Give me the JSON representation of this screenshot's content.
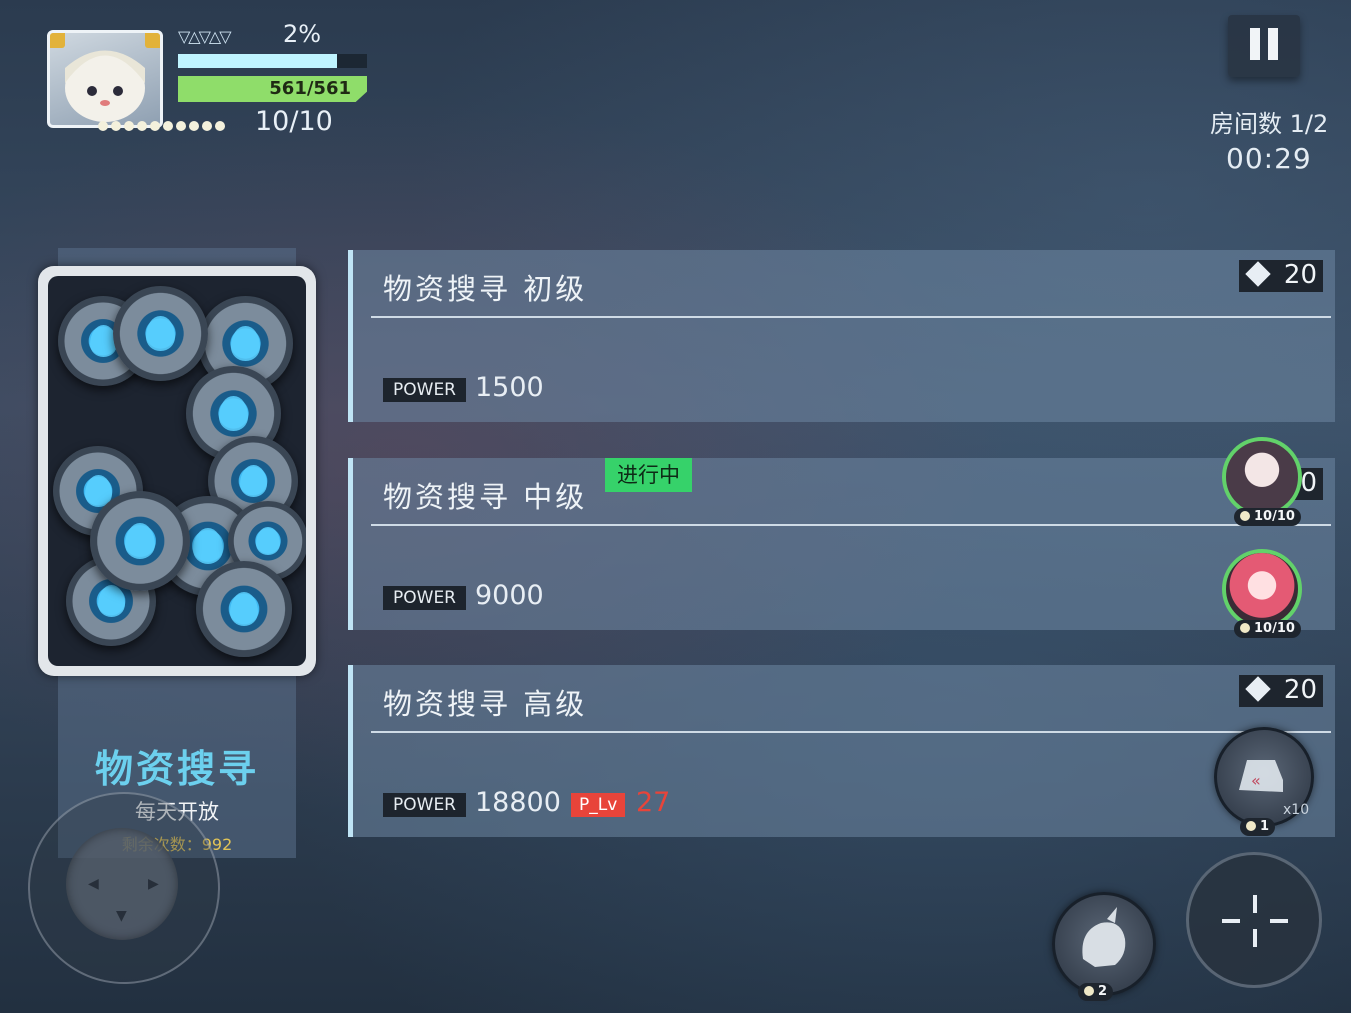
{
  "hud": {
    "rank_marks": "▽△▽△▽",
    "xp_percent_label": "2%",
    "xp_fraction": 0.84,
    "hp_label": "561/561",
    "energy_dots": 10,
    "energy_label": "10/10"
  },
  "top_right": {
    "room_label": "房间数  1/2",
    "timer": "00:29"
  },
  "left_panel": {
    "title": "物资搜寻",
    "subtitle": "每天开放",
    "remaining": "剩余次数：992"
  },
  "missions": [
    {
      "title": "物资搜寻 初级",
      "power_tag": "POWER",
      "power": "1500",
      "cost": "20"
    },
    {
      "title": "物资搜寻 中级",
      "status": "进行中",
      "power_tag": "POWER",
      "power": "9000",
      "cost": "0"
    },
    {
      "title": "物资搜寻 高级",
      "power_tag": "POWER",
      "power": "18800",
      "plv_tag": "P_Lv",
      "plv": "27",
      "cost": "20"
    }
  ],
  "team": [
    {
      "count": "10/10"
    },
    {
      "count": "10/10"
    }
  ],
  "skills": {
    "skill_a_count": "1",
    "skill_a_stack": "x10",
    "skill_b_count": "2"
  },
  "colors": {
    "accent_cyan": "#6cd0ee",
    "hp_green": "#8fdd6a",
    "status_green": "#36d26a",
    "warn_red": "#e8443a"
  }
}
